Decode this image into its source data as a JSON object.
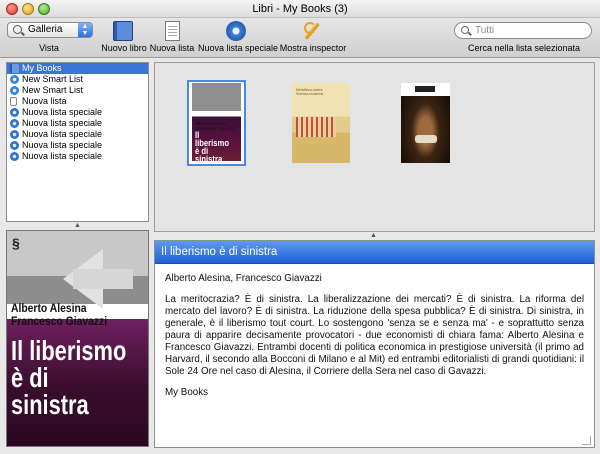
{
  "window": {
    "title": "Libri - My Books (3)"
  },
  "toolbar": {
    "view_value": "Galleria",
    "view_label": "Vista",
    "new_book_label": "Nuovo libro",
    "new_list_label": "Nuova lista",
    "new_special_list_label": "Nuova lista speciale",
    "show_inspector_label": "Mostra inspector",
    "search_placeholder": "Tutti",
    "search_label": "Cerca nella lista selezionata"
  },
  "sidebar": {
    "items": [
      {
        "label": "My Books",
        "icon": "books-icon",
        "selected": true
      },
      {
        "label": "New Smart List",
        "icon": "smart-list-icon"
      },
      {
        "label": "New Smart List",
        "icon": "smart-list-icon"
      },
      {
        "label": "Nuova lista",
        "icon": "list-icon"
      },
      {
        "label": "Nuova lista speciale",
        "icon": "special-list-icon"
      },
      {
        "label": "Nuova lista speciale",
        "icon": "special-list-icon"
      },
      {
        "label": "Nuova lista speciale",
        "icon": "special-list-icon"
      },
      {
        "label": "Nuova lista speciale",
        "icon": "special-list-icon"
      },
      {
        "label": "Nuova lista speciale",
        "icon": "special-list-icon"
      }
    ]
  },
  "gallery": {
    "covers": [
      {
        "lines": [
          "Alberto Alesina",
          "Francesco Giavazzi"
        ],
        "title": "Il liberismo è di sinistra",
        "selected": true
      },
      {
        "lines": [
          "Metafisica contra",
          "Scienza moderna"
        ]
      },
      {
        "lines": []
      }
    ]
  },
  "preview": {
    "authors_line1": "Alberto Alesina",
    "authors_line2": "Francesco Giavazzi",
    "title_line1": "Il liberismo",
    "title_line2": "è di",
    "title_line3": "sinistra"
  },
  "detail": {
    "title": "Il liberismo è di sinistra",
    "authors": "Alberto Alesina, Francesco Giavazzi",
    "description": "La meritocrazia? È di sinistra. La liberalizzazione dei mercati? È di sinistra. La riforma del mercato del lavoro? È di sinistra. La riduzione della spesa pubblica? È di sinistra. Di sinistra, in generale, è il liberismo tout court. Lo sostengono 'senza se e senza ma' - e soprattutto senza paura di apparire decisamente provocatori - due economisti di chiara fama: Alberto Alesina e Francesco Giavazzi. Entrambi docenti di politica economica in prestigiose università (il primo ad Harvard, il secondo alla Bocconi di Milano e al Mit) ed entrambi editorialisti di grandi quotidiani: il Sole 24 Ore nel caso di Alesina, il Corriere della Sera nel caso di Gavazzi.",
    "list": "My Books"
  },
  "colors": {
    "selection": "#3b73d6",
    "detail_header": "#2f6fdd"
  }
}
